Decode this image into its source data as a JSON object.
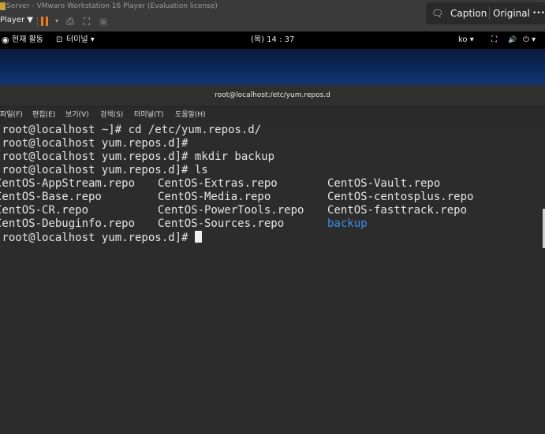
{
  "vmware": {
    "title": "Server - VMware Workstation 16 Player (Evaluation license)",
    "player_menu": "Player ▼",
    "win_min": "–",
    "win_max": "□"
  },
  "floating": {
    "caption": "Caption",
    "original": "Original",
    "more": "•••"
  },
  "gnome": {
    "activities": "현재 활동",
    "app_menu": "터미널 ▾",
    "clock": "(목) 14 : 37",
    "lang": "ko ▾",
    "network": "⛶",
    "volume": "🔊",
    "power": "⏻ ▾"
  },
  "terminal": {
    "title": "root@localhost:/etc/yum.repos.d",
    "menu": [
      "파일(F)",
      "편집(E)",
      "보기(V)",
      "검색(S)",
      "터미널(T)",
      "도움말(H)"
    ],
    "lines": [
      "[root@localhost ~]# cd /etc/yum.repos.d/",
      "[root@localhost yum.repos.d]#",
      "[root@localhost yum.repos.d]# mkdir backup",
      "[root@localhost yum.repos.d]# ls"
    ],
    "ls_rows": [
      [
        "CentOS-AppStream.repo",
        "CentOS-Extras.repo",
        "CentOS-Vault.repo"
      ],
      [
        "CentOS-Base.repo",
        "CentOS-Media.repo",
        "CentOS-centosplus.repo"
      ],
      [
        "CentOS-CR.repo",
        "CentOS-PowerTools.repo",
        "CentOS-fasttrack.repo"
      ],
      [
        "CentOS-Debuginfo.repo",
        "CentOS-Sources.repo",
        "backup"
      ]
    ],
    "final_prompt": "[root@localhost yum.repos.d]# "
  },
  "colors": {
    "directory": "#3b8eea",
    "pause_icon": "#f07b1e"
  }
}
